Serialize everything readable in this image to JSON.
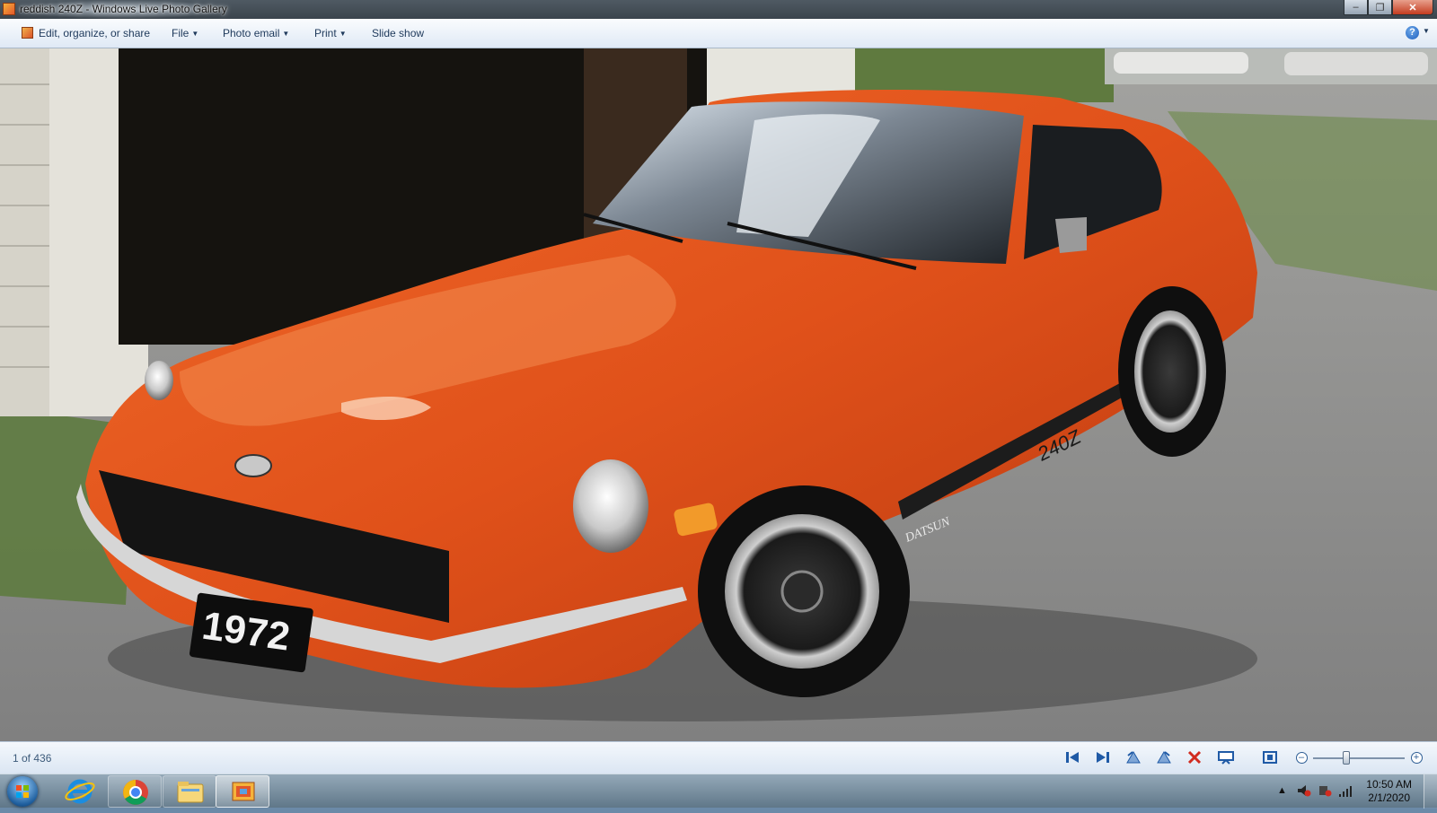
{
  "window": {
    "title": "reddish 240Z - Windows Live Photo Gallery",
    "buttons": {
      "minimize": "–",
      "maximize": "❐",
      "close": "✕"
    }
  },
  "menubar": {
    "items": [
      {
        "label": "Edit, organize, or share",
        "has_dropdown": false
      },
      {
        "label": "File",
        "has_dropdown": true
      },
      {
        "label": "Photo email",
        "has_dropdown": true
      },
      {
        "label": "Print",
        "has_dropdown": true
      },
      {
        "label": "Slide show",
        "has_dropdown": false
      }
    ],
    "help_icon": "help-icon"
  },
  "photo": {
    "description_icon": "photo-image",
    "plate_text": "1972",
    "badge_text": "240Z",
    "script_text": "DATSUN",
    "colors": {
      "car": "#e2511a",
      "car_shadow": "#a8330d",
      "gravel": "#8f8f8b",
      "grass": "#5c7a3c",
      "garage": "#e6e4dc"
    }
  },
  "statusbar": {
    "counter": "1 of 436",
    "controls": [
      "previous-icon",
      "next-icon",
      "rotate-left-icon",
      "rotate-right-icon",
      "delete-icon",
      "slideshow-icon",
      "fit-window-icon",
      "zoom-out-icon",
      "zoom-slider",
      "zoom-in-icon"
    ]
  },
  "taskbar": {
    "apps": [
      "internet-explorer-icon",
      "chrome-icon",
      "file-explorer-icon",
      "photo-gallery-icon"
    ],
    "clock": {
      "time": "10:50 AM",
      "date": "2/1/2020"
    }
  }
}
